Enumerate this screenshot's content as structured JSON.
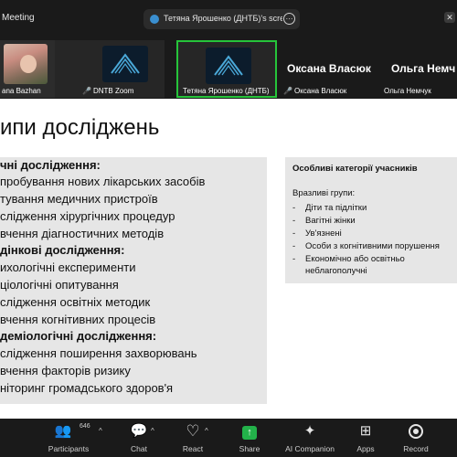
{
  "window": {
    "title": "Meeting"
  },
  "share_tab": {
    "label": "Тетяна Ярошенко (ДНТБ)'s scree",
    "more": "⋯"
  },
  "gallery": [
    {
      "name": "ana Bazhan",
      "type": "photo"
    },
    {
      "name": "DNTB Zoom",
      "type": "logo",
      "muted": true
    },
    {
      "name": "Тетяна Ярошенко (ДНТБ)",
      "type": "logo",
      "active": true
    },
    {
      "name": "Оксана Власюк",
      "type": "name",
      "muted": true
    },
    {
      "name": "Ольга Немчук",
      "type": "name"
    }
  ],
  "gallery_big_names": [
    "Оксана Власюк",
    "Ольга Немч"
  ],
  "slide": {
    "title": "ипи досліджень",
    "left_lines": [
      {
        "text": "чні дослідження:",
        "bold": true
      },
      {
        "text": "пробування нових лікарських засобів",
        "bold": false
      },
      {
        "text": "тування медичних пристроїв",
        "bold": false
      },
      {
        "text": "слідження хірургічних процедур",
        "bold": false
      },
      {
        "text": "вчення діагностичних методів",
        "bold": false
      },
      {
        "text": "дінкові дослідження:",
        "bold": true
      },
      {
        "text": "ихологічні експерименти",
        "bold": false
      },
      {
        "text": "ціологічні опитування",
        "bold": false
      },
      {
        "text": "слідження освітніх методик",
        "bold": false
      },
      {
        "text": "вчення когнітивних процесів",
        "bold": false
      },
      {
        "text": "деміологічні дослідження:",
        "bold": true
      },
      {
        "text": "слідження поширення захворювань",
        "bold": false
      },
      {
        "text": "вчення факторів ризику",
        "bold": false
      },
      {
        "text": "ніторинг громадського здоров'я",
        "bold": false
      }
    ],
    "right_box": {
      "title": "Особливі категорії учасників",
      "subtitle": "Вразливі групи:",
      "items": [
        "Діти та підлітки",
        "Вагітні жінки",
        "Ув'язнені",
        "Особи з когнітивними порушення",
        "Економічно або освітньо",
        "неблагополучні"
      ]
    }
  },
  "toolbar": {
    "participants_count": "646",
    "buttons": [
      {
        "label": "Participants",
        "icon": "participants-icon",
        "glyph": "👥"
      },
      {
        "label": "Chat",
        "icon": "chat-icon",
        "glyph": "💬"
      },
      {
        "label": "React",
        "icon": "heart-icon",
        "glyph": "♡"
      },
      {
        "label": "Share",
        "icon": "share-arrow-icon",
        "glyph": "↑"
      },
      {
        "label": "AI Companion",
        "icon": "sparkle-icon",
        "glyph": "✦"
      },
      {
        "label": "Apps",
        "icon": "apps-grid-icon",
        "glyph": "⊞"
      },
      {
        "label": "Record",
        "icon": "record-icon",
        "glyph": ""
      }
    ]
  },
  "colors": {
    "active_border": "#26c43a",
    "share_green": "#23b24a",
    "muted_red": "#e04040",
    "slide_box": "#e6e6e6"
  }
}
